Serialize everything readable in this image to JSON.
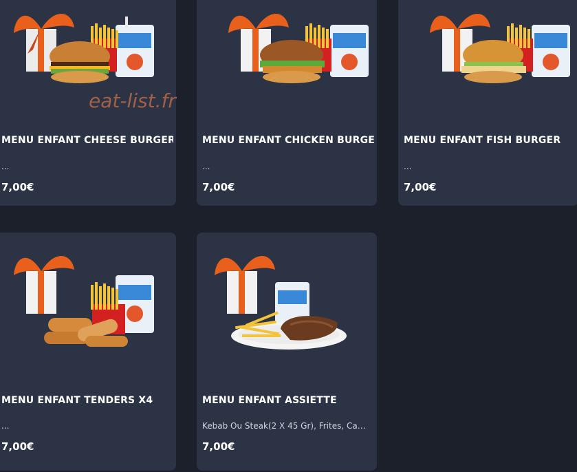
{
  "watermark": "eat-list.fr",
  "menu": {
    "items": [
      {
        "title": "MENU ENFANT CHEESE BURGER",
        "description": "...",
        "price": "7,00€",
        "image": "kids-menu-cheeseburger"
      },
      {
        "title": "MENU ENFANT CHICKEN BURGER",
        "description": "...",
        "price": "7,00€",
        "image": "kids-menu-chickenburger"
      },
      {
        "title": "MENU ENFANT FISH BURGER",
        "description": "...",
        "price": "7,00€",
        "image": "kids-menu-fishburger"
      },
      {
        "title": "MENU ENFANT TENDERS X4",
        "description": "...",
        "price": "7,00€",
        "image": "kids-menu-tenders"
      },
      {
        "title": "MENU ENFANT ASSIETTE",
        "description": "Kebab Ou Steak(2 X 45 Gr), Frites, Cap...",
        "price": "7,00€",
        "image": "kids-menu-plate"
      }
    ]
  },
  "colors": {
    "background": "#1b202b",
    "card": "#2b3344",
    "gift_ribbon": "#e8601c",
    "watermark": "#b0654a"
  }
}
